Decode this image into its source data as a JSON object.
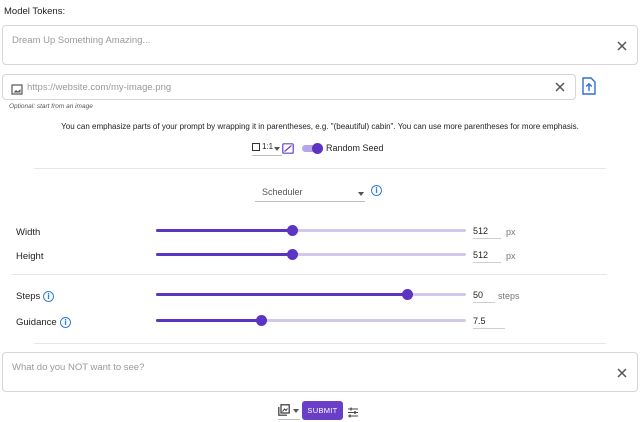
{
  "model_tokens_label": "Model Tokens:",
  "prompt": {
    "placeholder": "Dream Up Something Amazing...",
    "value": ""
  },
  "image_url": {
    "placeholder": "https://website.com/my-image.png",
    "hint": "Optional: start from an image"
  },
  "info_text": "You can emphasize parts of your prompt by wrapping it in parentheses, e.g. \"(beautiful) cabin\". You can use more parentheses for more emphasis.",
  "toolbar": {
    "aspect_ratio": "1:1",
    "random_seed_label": "Random Seed",
    "random_seed_on": true
  },
  "scheduler": {
    "selected": "Scheduler"
  },
  "width": {
    "label": "Width",
    "value": "512",
    "unit": "px",
    "fraction": 0.44
  },
  "height": {
    "label": "Height",
    "value": "512",
    "unit": "px",
    "fraction": 0.44
  },
  "steps": {
    "label": "Steps",
    "value": "50",
    "unit": "steps",
    "fraction": 0.81
  },
  "guidance": {
    "label": "Guidance",
    "value": "7.5",
    "fraction": 0.34
  },
  "negative_prompt": {
    "placeholder": "What do you NOT want to see?"
  },
  "submit_label": "SUBMIT",
  "colors": {
    "accent": "#5b34c2",
    "accent_light": "#d3c8ec",
    "info": "#2f7fd6"
  }
}
